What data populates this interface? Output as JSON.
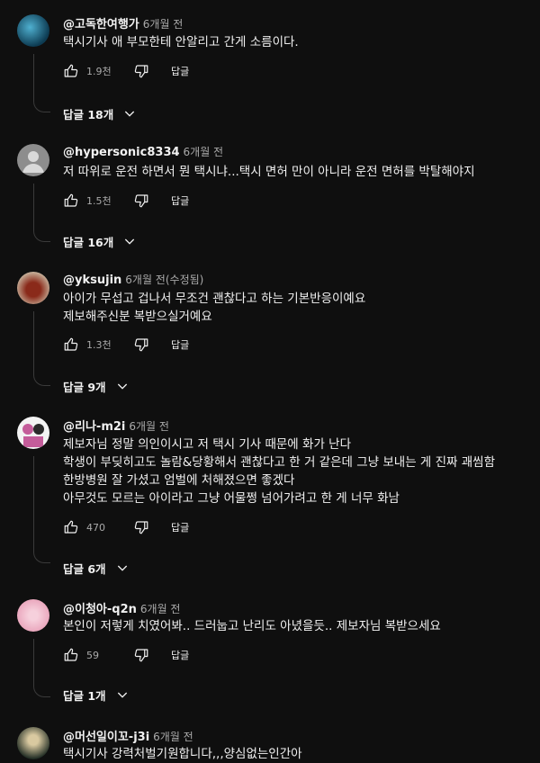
{
  "comments": [
    {
      "author": "@고독한여행가",
      "time": "6개월 전",
      "lines": [
        "택시기사 애 부모한테 안알리고 간게 소름이다."
      ],
      "likes": "1.9천",
      "reply_label": "답글",
      "replies_label": "답글 18개",
      "avatar_color": "#1f5f7a"
    },
    {
      "author": "@hypersonic8334",
      "time": "6개월 전",
      "lines": [
        "저 따위로 운전 하면서 뭔 택시냐...택시 면허 만이 아니라 운전 면허를 박탈해야지"
      ],
      "likes": "1.5천",
      "reply_label": "답글",
      "replies_label": "답글 16개",
      "avatar_color": "#8d8d8d"
    },
    {
      "author": "@yksujin",
      "time": "6개월 전(수정됨)",
      "lines": [
        "아이가 무섭고 겁나서 무조건 괜찮다고 하는 기본반응이예요",
        "제보해주신분 복받으실거예요"
      ],
      "likes": "1.3천",
      "reply_label": "답글",
      "replies_label": "답글 9개",
      "avatar_color": "#7a3a2a"
    },
    {
      "author": "@리나-m2i",
      "time": "6개월 전",
      "lines": [
        "제보자님 정말 의인이시고 저 택시 기사 때문에 화가 난다",
        "학생이 부딪히고도 놀람&당황해서 괜찮다고 한 거 같은데 그냥 보내는 게 진짜 괘씸함",
        "한방병원 잘 가셨고 엄벌에 처해졌으면 좋겠다",
        "아무것도 모르는 아이라고 그냥 어물쩡 넘어가려고 한 게 너무 화남"
      ],
      "likes": "470",
      "reply_label": "답글",
      "replies_label": "답글 6개",
      "avatar_color": "#c45c9a"
    },
    {
      "author": "@이청아-q2n",
      "time": "6개월 전",
      "lines": [
        "본인이 저렇게 치였어봐.. 드러눕고 난리도 아녔을듯.. 제보자님 복받으세요"
      ],
      "likes": "59",
      "reply_label": "답글",
      "replies_label": "답글 1개",
      "avatar_color": "#e8a0b8"
    },
    {
      "author": "@머선일이꼬-j3i",
      "time": "6개월 전",
      "lines": [
        "택시기사 강력처벌기원합니다,,,양심없는인간아"
      ],
      "likes": "",
      "reply_label": "",
      "replies_label": "",
      "avatar_color": "#d9c9a0"
    }
  ]
}
